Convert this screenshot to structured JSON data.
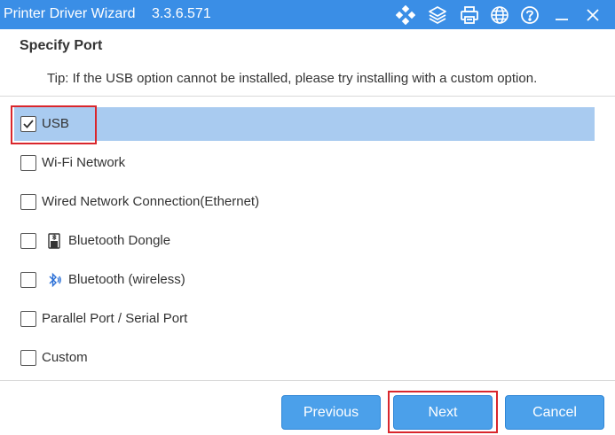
{
  "window": {
    "title": "Printer Driver Wizard",
    "version": "3.3.6.571",
    "toolbar_icons": [
      "diamond-grid-icon",
      "layers-icon",
      "printer-icon",
      "globe-icon",
      "help-icon",
      "minimize-icon",
      "close-icon"
    ]
  },
  "page": {
    "heading": "Specify Port",
    "tip": "Tip: If the USB option cannot be installed, please try installing with a custom option."
  },
  "options": [
    {
      "label": "USB",
      "checked": true,
      "selected": true
    },
    {
      "label": "Wi-Fi Network",
      "checked": false
    },
    {
      "label": "Wired Network Connection(Ethernet)",
      "checked": false
    },
    {
      "label": "Bluetooth Dongle",
      "checked": false,
      "icon": "bluetooth-dongle-icon"
    },
    {
      "label": "Bluetooth (wireless)",
      "checked": false,
      "icon": "bluetooth-icon"
    },
    {
      "label": "Parallel Port / Serial Port",
      "checked": false
    },
    {
      "label": "Custom",
      "checked": false
    }
  ],
  "buttons": {
    "previous": "Previous",
    "next": "Next",
    "cancel": "Cancel"
  },
  "colors": {
    "titlebar": "#3a8ee6",
    "selected_row": "#a9cbf0",
    "button": "#4ba0ea",
    "highlight": "#d9262c"
  }
}
